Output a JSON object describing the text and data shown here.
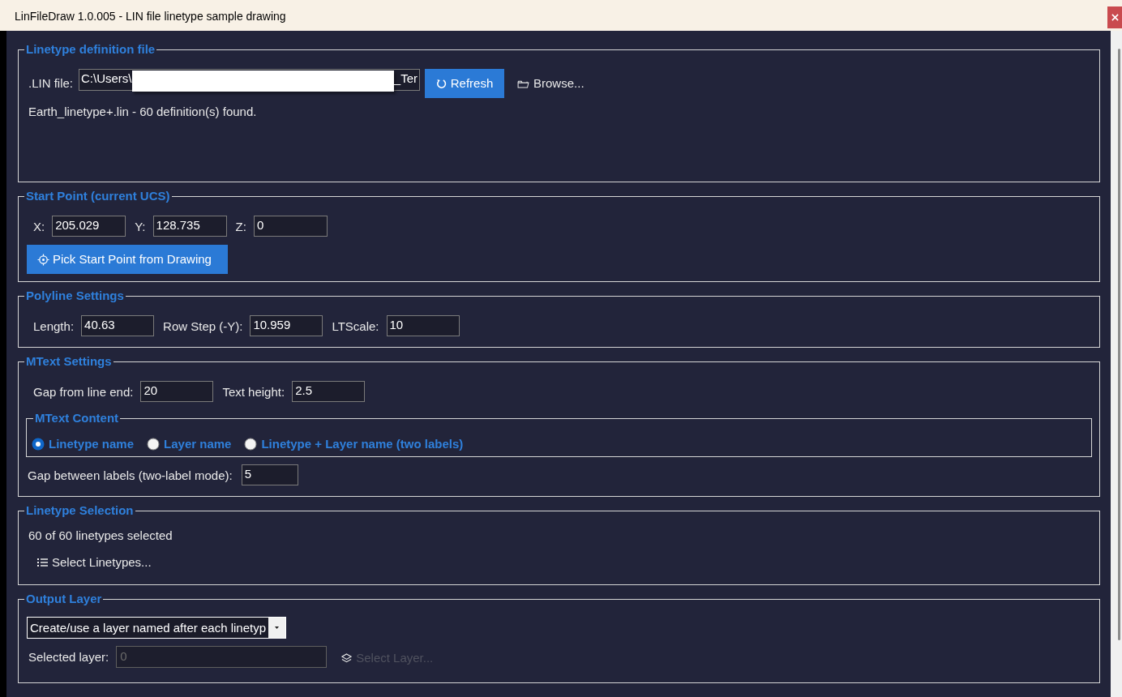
{
  "window": {
    "title": "LinFileDraw 1.0.005 - LIN file linetype sample drawing"
  },
  "linetype_definition_file": {
    "title": "Linetype definition file",
    "lin_file": {
      "label": ".LIN file:",
      "value_start": "C:\\Users\\",
      "redacted": true,
      "value_end": "_Ter"
    },
    "refresh_button": {
      "label": "Refresh"
    },
    "browse_button": {
      "label": "Browse..."
    },
    "status": "Earth_linetype+.lin - 60 definition(s) found."
  },
  "start_point": {
    "title": "Start Point (current UCS)",
    "fields": [
      {
        "label": "X:",
        "value": "205.029"
      },
      {
        "label": "Y:",
        "value": "128.735"
      },
      {
        "label": "Z:",
        "value": "0"
      }
    ],
    "pick_button": {
      "label": "Pick Start Point from Drawing"
    }
  },
  "polyline_settings": {
    "title": "Polyline Settings",
    "fields": [
      {
        "label": "Length:",
        "value": "40.63"
      },
      {
        "label": "Row Step (-Y):",
        "value": "10.959"
      },
      {
        "label": "LTScale:",
        "value": "10"
      }
    ]
  },
  "mtext_settings": {
    "title": "MText Settings",
    "fields": [
      {
        "label": "Gap from line end:",
        "value": "20"
      },
      {
        "label": "Text height:",
        "value": "2.5"
      }
    ],
    "mtext_content": {
      "title": "MText Content",
      "options": [
        {
          "label": "Linetype name",
          "selected": true
        },
        {
          "label": "Layer name",
          "selected": false
        },
        {
          "label": "Linetype + Layer name (two labels)",
          "selected": false
        }
      ]
    },
    "gap_between_labels": {
      "label": "Gap between labels (two-label mode):",
      "value": "5"
    }
  },
  "linetype_selection": {
    "title": "Linetype Selection",
    "summary": "60 of 60 linetypes selected",
    "select_button": {
      "label": "Select Linetypes..."
    }
  },
  "output_layer": {
    "title": "Output Layer",
    "layer_mode": {
      "value": "Create/use a layer named after each linetyp"
    },
    "selected_layer": {
      "label": "Selected layer:",
      "value": "0",
      "disabled": true
    },
    "select_layer_button": {
      "label": "Select Layer...",
      "disabled": true
    }
  }
}
